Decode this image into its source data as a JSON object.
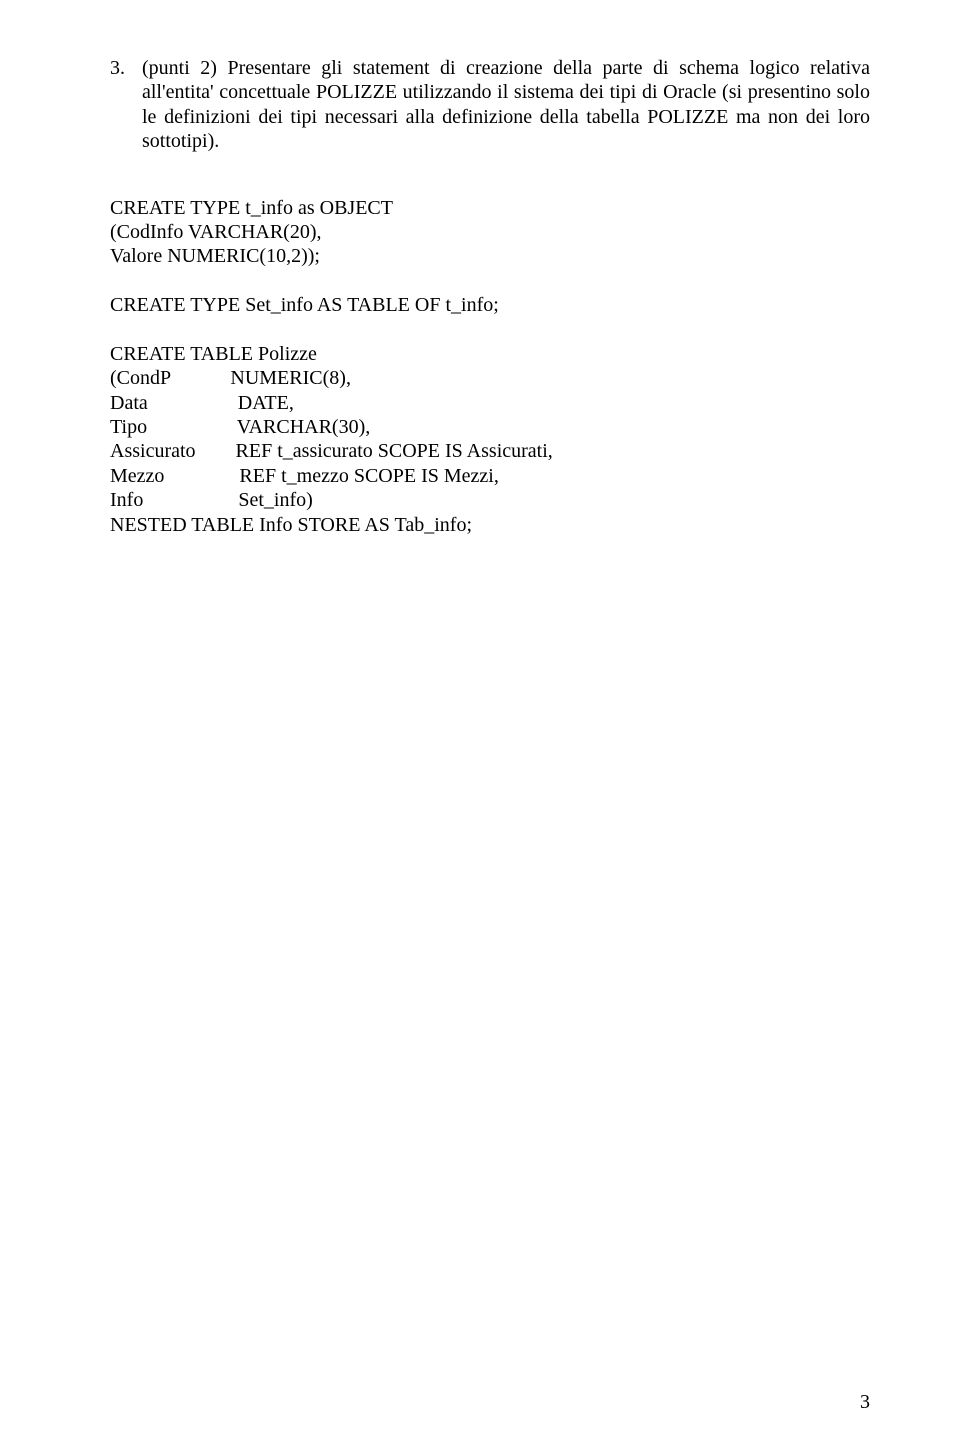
{
  "question": {
    "number": "3.",
    "text": "(punti 2) Presentare gli statement di creazione della parte di schema logico relativa all'entita' concettuale POLIZZE utilizzando il sistema dei tipi di Oracle (si presentino solo le definizioni dei tipi necessari alla definizione della tabella POLIZZE ma non dei loro sottotipi)."
  },
  "answer": {
    "line01": "CREATE TYPE t_info as OBJECT",
    "line02": "(CodInfo VARCHAR(20),",
    "line03": "Valore NUMERIC(10,2));",
    "line04": "",
    "line05": "CREATE TYPE Set_info AS TABLE OF t_info;",
    "line06": "",
    "line07": "CREATE TABLE Polizze",
    "line08_col1": "(CondP",
    "line08_col2": "NUMERIC(8),",
    "line09_col1": "Data",
    "line09_col2": "DATE,",
    "line10_col1": "Tipo",
    "line10_col2": "VARCHAR(30),",
    "line11_col1": "Assicurato",
    "line11_col2": "REF t_assicurato SCOPE IS Assicurati,",
    "line12_col1": "Mezzo",
    "line12_col2": "REF t_mezzo SCOPE IS Mezzi,",
    "line13_col1": "Info",
    "line13_col2": "Set_info)",
    "line14": "NESTED TABLE Info STORE AS Tab_info;"
  },
  "page_number": "3"
}
